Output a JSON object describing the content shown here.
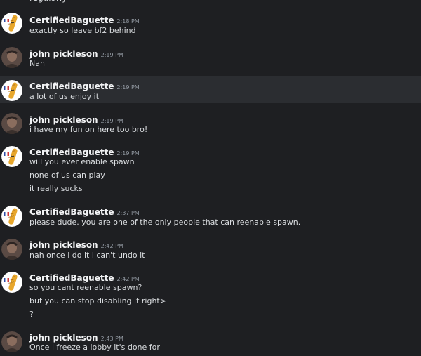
{
  "clipped_text": "regularly",
  "users": {
    "baguette": "CertifiedBaguette",
    "john": "john pickleson"
  },
  "messages": [
    {
      "time": "2:18 PM",
      "lines": [
        "exactly so leave bf2 behind"
      ]
    },
    {
      "time": "2:19 PM",
      "lines": [
        "Nah"
      ]
    },
    {
      "time": "2:19 PM",
      "lines": [
        "a lot of us enjoy it"
      ]
    },
    {
      "time": "2:19 PM",
      "lines": [
        "i have my fun on here too bro!"
      ]
    },
    {
      "time": "2:19 PM",
      "lines": [
        "will you ever enable spawn",
        "none of us can play",
        "it really sucks"
      ]
    },
    {
      "time": "2:37 PM",
      "lines": [
        "please dude. you are one of the only people that can reenable spawn."
      ]
    },
    {
      "time": "2:42 PM",
      "lines": [
        "nah once i do it i can't undo it"
      ]
    },
    {
      "time": "2:42 PM",
      "lines": [
        "so you cant reenable spawn?",
        "but you can stop disabling it right>",
        "?"
      ]
    },
    {
      "time": "2:43 PM",
      "lines": [
        "Once i freeze a lobby it's done for"
      ]
    }
  ],
  "colors": {
    "background": "#1e1f22",
    "hover_background": "#2b2d31",
    "username": "#f2f3f5",
    "text": "#dbdee1",
    "timestamp": "#949ba4"
  },
  "icons": {
    "baguette_avatar": "baguette-avatar-icon",
    "john_avatar": "john-avatar-icon"
  }
}
